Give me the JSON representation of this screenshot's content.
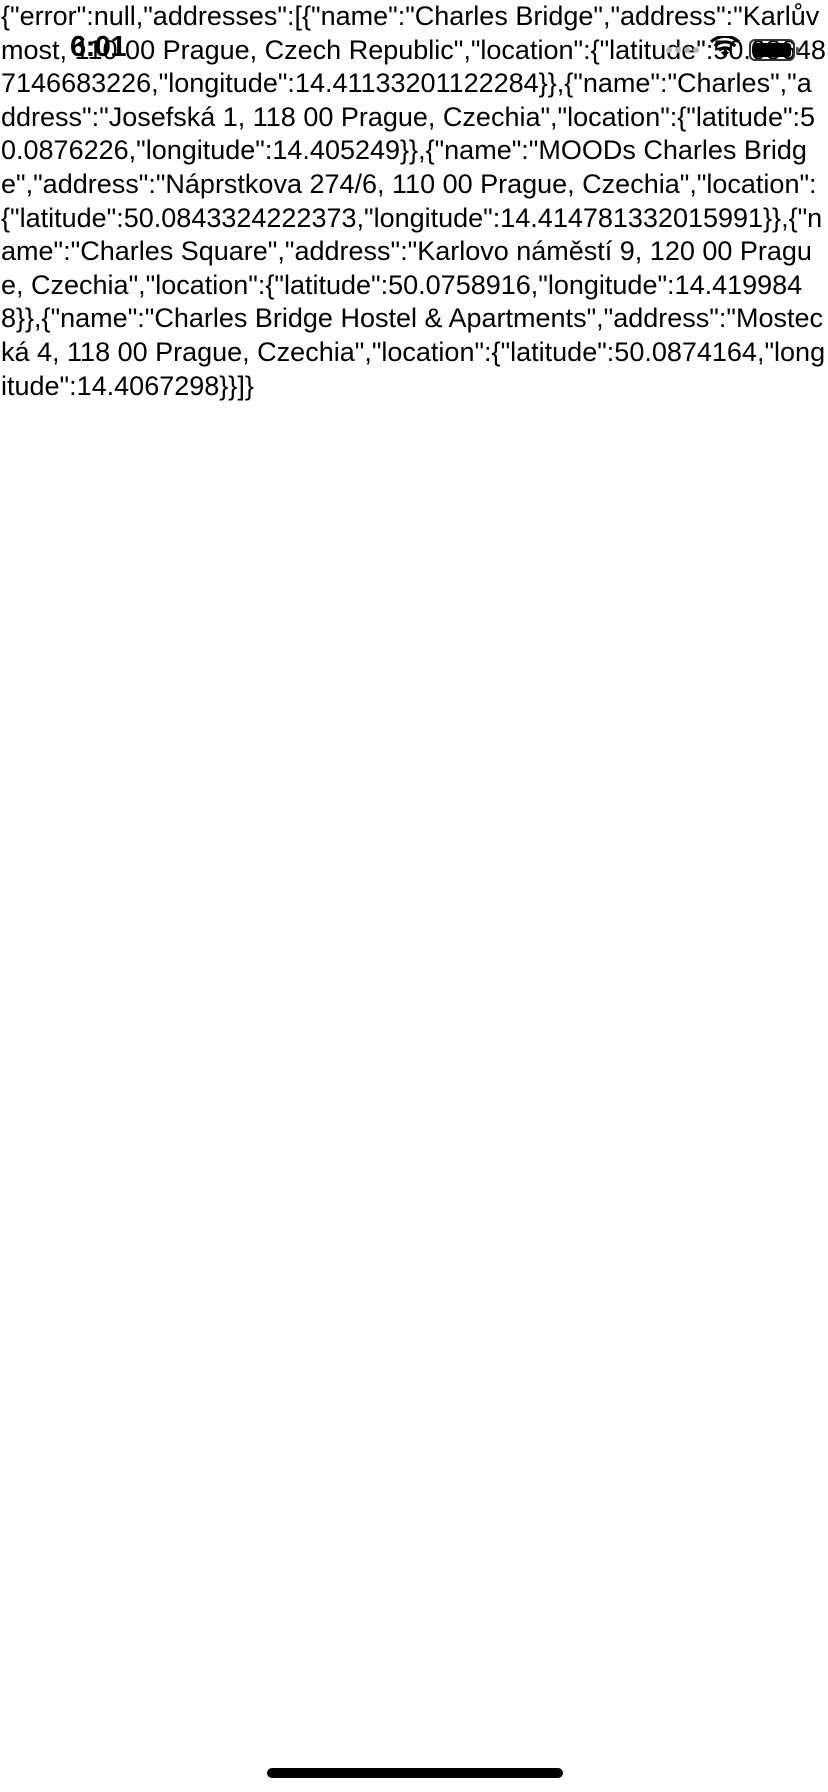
{
  "status_bar": {
    "time": "6:01",
    "wifi_icon": "wifi-icon",
    "battery_icon": "battery-icon",
    "battery_level": 1.0
  },
  "content": {
    "json_text": "{\"error\":null,\"addresses\":[{\"name\":\"Charles Bridge\",\"address\":\"Karlův most, 110 00 Prague, Czech Republic\",\"location\":{\"latitude\":50.086487146683226,\"longitude\":14.41133201122284}},{\"name\":\"Charles\",\"address\":\"Josefská 1, 118 00 Prague, Czechia\",\"location\":{\"latitude\":50.0876226,\"longitude\":14.405249}},{\"name\":\"MOODs Charles Bridge\",\"address\":\"Náprstkova 274/6, 110 00 Prague, Czechia\",\"location\":{\"latitude\":50.0843324222373,\"longitude\":14.414781332015991}},{\"name\":\"Charles Square\",\"address\":\"Karlovo náměstí 9, 120 00 Prague, Czechia\",\"location\":{\"latitude\":50.0758916,\"longitude\":14.4199848}},{\"name\":\"Charles Bridge Hostel & Apartments\",\"address\":\"Mostecká 4, 118 00 Prague, Czechia\",\"location\":{\"latitude\":50.0874164,\"longitude\":14.4067298}}]}"
  }
}
